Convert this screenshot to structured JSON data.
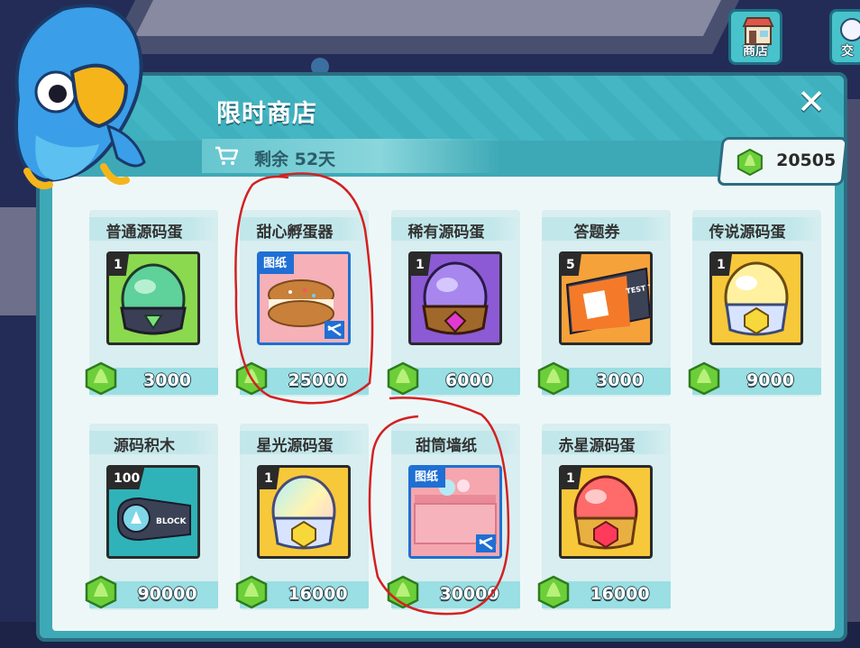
{
  "top_buttons": [
    {
      "label": "商店"
    },
    {
      "label": "交"
    }
  ],
  "panel": {
    "title": "限时商店",
    "timer": "剩余 52天",
    "close": "✕"
  },
  "currency": {
    "icon": "green-gem-icon",
    "amount": "20505"
  },
  "items": [
    {
      "name": "普通源码蛋",
      "count": "1",
      "price": "3000",
      "icon": "green-egg-icon"
    },
    {
      "name": "甜心孵蛋器",
      "badge": "图纸",
      "price": "25000",
      "icon": "cookie-incubator-icon"
    },
    {
      "name": "稀有源码蛋",
      "count": "1",
      "price": "6000",
      "icon": "purple-egg-icon"
    },
    {
      "name": "答题券",
      "count": "5",
      "price": "3000",
      "icon": "quiz-ticket-icon"
    },
    {
      "name": "传说源码蛋",
      "count": "1",
      "price": "9000",
      "icon": "legend-egg-icon"
    },
    {
      "name": "源码积木",
      "count": "100",
      "price": "90000",
      "icon": "code-block-icon"
    },
    {
      "name": "星光源码蛋",
      "count": "1",
      "price": "16000",
      "icon": "starlight-egg-icon"
    },
    {
      "name": "甜筒墙纸",
      "badge": "图纸",
      "price": "30000",
      "icon": "cone-wallpaper-icon"
    },
    {
      "name": "赤星源码蛋",
      "count": "1",
      "price": "16000",
      "icon": "red-star-egg-icon"
    }
  ],
  "ticket_text": "TEST T",
  "block_text": "BLOCK",
  "colors": {
    "panel": "#3ea9b6",
    "panel_border": "#2b6d82",
    "price_bar": "#9adfe3",
    "highlight_circle": "#d42020"
  }
}
